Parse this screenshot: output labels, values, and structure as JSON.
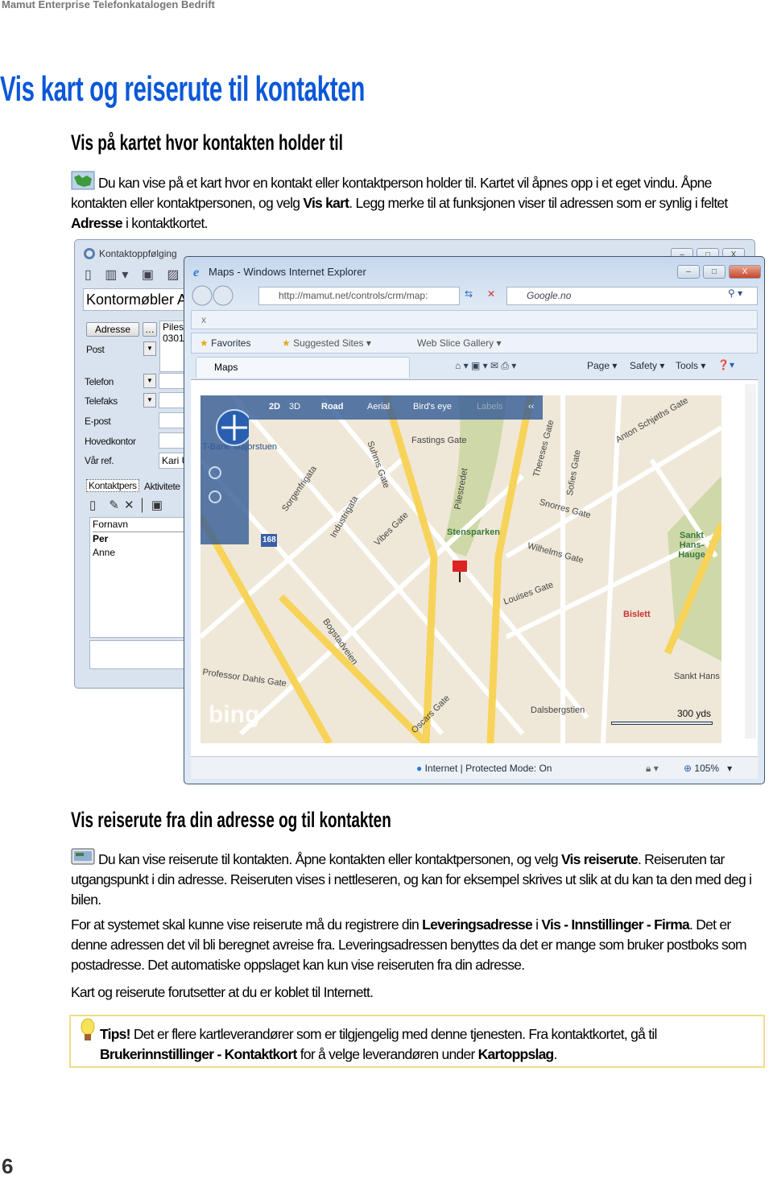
{
  "header": "Mamut Enterprise Telefonkatalogen Bedrift",
  "title": "Vis kart og reiserute til kontakten",
  "section1": {
    "heading": "Vis på kartet hvor kontakten holder til",
    "icon": "map-icon",
    "p1": "Du kan vise på et kart hvor en kontakt eller kontaktperson holder til. Kartet vil åpnes opp i et eget vindu. Åpne kontakten eller kontaktpersonen, og velg ",
    "p1_b1": "Vis kart",
    "p1_2": ". Legg merke til at funksjonen viser til adressen som er synlig i feltet ",
    "p1_b2": "Adresse",
    "p1_3": " i kontaktkortet."
  },
  "screenshot": {
    "back_window": {
      "title": "Kontaktoppfølging",
      "company": "Kontormøbler A",
      "address_button": "Adresse",
      "address_value": "Pilest",
      "address_zip": "0301",
      "labels": [
        "Post",
        "Telefon",
        "Telefaks",
        "E-post",
        "Hovedkontor",
        "Vår ref."
      ],
      "our_ref_value": "Kari U",
      "tabs": [
        "Kontaktpers",
        "Aktivitete"
      ],
      "column_header": "Fornavn",
      "rows": [
        "Per",
        "Anne"
      ]
    },
    "ie_window": {
      "title": "Maps - Windows Internet Explorer",
      "url": "http://mamut.net/controls/crm/map:",
      "search": "Google.no",
      "favorites": "Favorites",
      "suggested_sites": "Suggested Sites ▾",
      "web_slice": "Web Slice Gallery ▾",
      "tab": "Maps",
      "page_menu": "Page ▾",
      "safety_menu": "Safety ▾",
      "tools_menu": "Tools ▾",
      "map_modes": [
        "2D",
        "3D",
        "Road",
        "Aerial",
        "Bird's eye",
        "Labels",
        "‹‹"
      ],
      "map_labels": [
        "Fastings Gate",
        "Thereses Gate",
        "Stensparken",
        "Sankt Hans-Hauge",
        "Bislett",
        "Louises Gate",
        "Bogstadveien",
        "Professor Dahls Gate",
        "Dalsbergstien",
        "Sorgenfrigata",
        "Suhms Gate",
        "Oscars Gate",
        "Sofies Gate",
        "Pilestredet",
        "T-Bane Majorstuen",
        "Industrigata",
        "Vibes Gate",
        "Snorres Gate",
        "Wilhelms Gate",
        "Anton Schjøths Gate",
        "Sankt Hans"
      ],
      "route_badge": "168",
      "scale": "300 yds",
      "logo": "bing",
      "status": "Internet | Protected Mode: On",
      "zoom": "105%"
    }
  },
  "section2": {
    "heading": "Vis reiserute fra din adresse og til kontakten",
    "icon": "route-icon",
    "p1": "Du kan vise reiserute til kontakten. Åpne kontakten eller kontaktpersonen, og velg ",
    "p1_b1": "Vis reiserute",
    "p1_2": ". Reiseruten tar utgangspunkt i din adresse. Reiseruten vises i nettleseren, og kan for eksempel skrives ut slik at du kan ta den med deg i bilen.",
    "p2": "For at systemet skal kunne vise reiserute må du registrere din ",
    "p2_b1": "Leveringsadresse",
    "p2_2": " i ",
    "p2_b2": "Vis - Innstillinger - Firma",
    "p2_3": ". Det er denne adressen det vil bli beregnet avreise fra. Leveringsadressen benyttes da det er mange som bruker postboks som postadresse. Det automatiske oppslaget kan kun vise reiseruten fra din adresse.",
    "p3": "Kart og reiserute forutsetter at du er koblet til Internett."
  },
  "tips": {
    "icon": "lightbulb-icon",
    "label": "Tips!",
    "t1": " Det er flere kartleverandører som er tilgjengelig med denne tjenesten. Fra kontaktkortet, gå til ",
    "b1": "Brukerinnstillinger",
    "t2": " - ",
    "b2": "Kontaktkort",
    "t3": " for å velge leverandøren under ",
    "b3": "Kartoppslag",
    "t4": "."
  },
  "page_number": "6",
  "colors": {
    "title": "#0b58d8",
    "tips_border": "#f0dc8a",
    "road": "#f7d35a",
    "park": "#cfd8a8"
  }
}
